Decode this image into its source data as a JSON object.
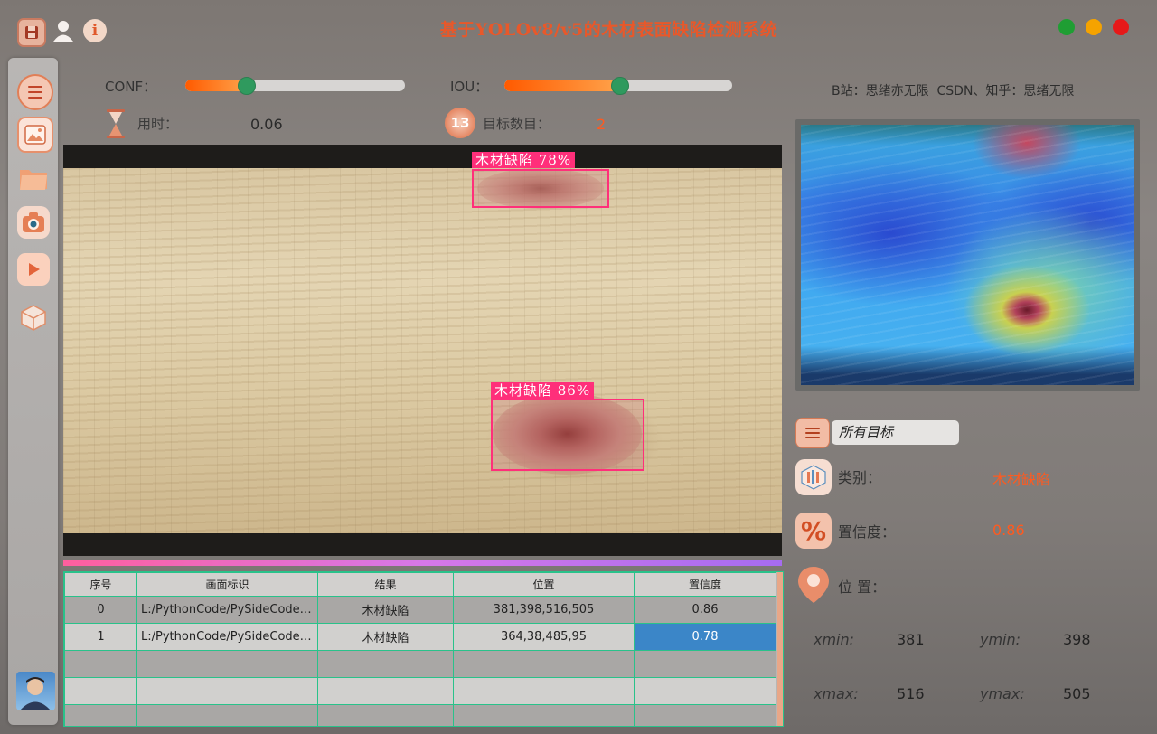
{
  "window": {
    "title": "基于YOLOv8/v5的木材表面缺陷检测系统",
    "buttons": [
      "#1f9e33",
      "#f5a300",
      "#e61919"
    ]
  },
  "toolbar": {
    "icons": [
      "save-icon",
      "user-icon",
      "info-icon"
    ]
  },
  "sidebar": {
    "items": [
      "menu-icon",
      "image-icon",
      "folder-icon",
      "camera-icon",
      "video-icon",
      "model-icon"
    ]
  },
  "controls": {
    "conf_label": "CONF：",
    "conf_value": 0.34,
    "iou_label": "IOU：",
    "iou_value": 0.5
  },
  "stats": {
    "time_label": "用时：",
    "time_value": "0.06",
    "count_label": "目标数目：",
    "count_value": "2"
  },
  "credits": "B站：思绪亦无限  CSDN、知乎：思绪无限",
  "detections": [
    {
      "label": "木材缺陷 78%"
    },
    {
      "label": "木材缺陷 86%"
    }
  ],
  "table": {
    "headers": [
      "序号",
      "画面标识",
      "结果",
      "位置",
      "置信度"
    ],
    "rows": [
      [
        "0",
        "L:/PythonCode/PySideCode/...",
        "木材缺陷",
        "381,398,516,505",
        "0.86"
      ],
      [
        "1",
        "L:/PythonCode/PySideCode/...",
        "木材缺陷",
        "364,38,485,95",
        "0.78"
      ]
    ]
  },
  "details": {
    "target_select": "所有目标",
    "class_label": "类别：",
    "class_value": "木材缺陷",
    "conf_label": "置信度：",
    "conf_value": "0.86",
    "pos_label": "位 置：",
    "xmin_label": "xmin:",
    "xmin": "381",
    "ymin_label": "ymin:",
    "ymin": "398",
    "xmax_label": "xmax:",
    "xmax": "516",
    "ymax_label": "ymax:",
    "ymax": "505"
  },
  "colors": {
    "accent": "#ff5a1f",
    "title": "#e8582a",
    "table_border": "#29c28a",
    "selected": "#3b86c8",
    "slider_knob": "#2f9a5e"
  }
}
